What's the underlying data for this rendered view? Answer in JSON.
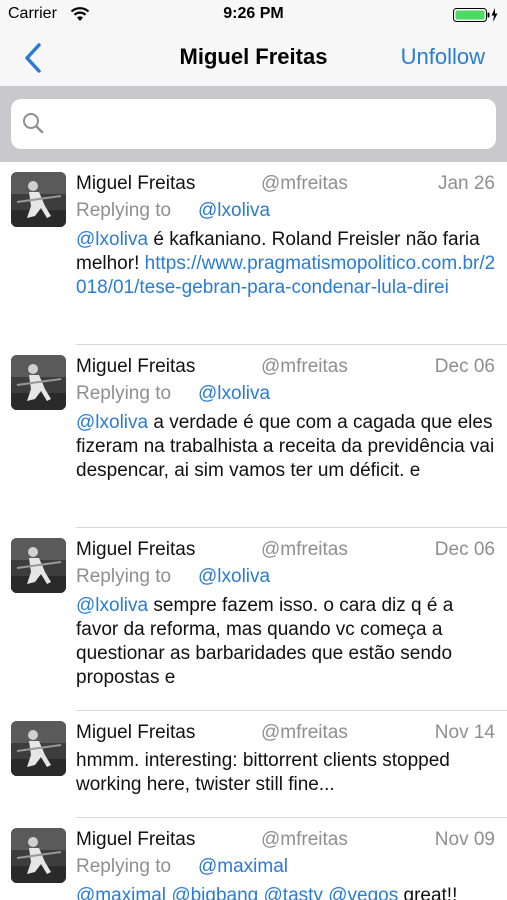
{
  "status_bar": {
    "carrier": "Carrier",
    "time": "9:26 PM",
    "icons": [
      "wifi-icon",
      "battery-icon"
    ],
    "battery_color": "#4cd964"
  },
  "nav": {
    "back_icon": "chevron-left-icon",
    "title": "Miguel Freitas",
    "unfollow_label": "Unfollow",
    "accent_color": "#2a7bd6"
  },
  "search": {
    "placeholder": "",
    "value": "",
    "icon": "search-icon"
  },
  "tweets": [
    {
      "name": "Miguel Freitas",
      "handle": "@mfreitas",
      "date": "Jan 26",
      "reply_prefix": "Replying to",
      "reply_user": "@lxoliva",
      "mention": "@lxoliva",
      "text": " é kafkaniano. Roland Freisler não faria melhor! ",
      "link": "https://www.pragmatismopolitico.com.br/2018/01/tese-gebran-para-condenar-lula-direi"
    },
    {
      "name": "Miguel Freitas",
      "handle": "@mfreitas",
      "date": "Dec 06",
      "reply_prefix": "Replying to",
      "reply_user": "@lxoliva",
      "mention": "@lxoliva",
      "text": " a verdade é que com a cagada que eles fizeram na trabalhista a receita da previdência vai despencar, ai sim vamos ter um déficit. e"
    },
    {
      "name": "Miguel Freitas",
      "handle": "@mfreitas",
      "date": "Dec 06",
      "reply_prefix": "Replying to",
      "reply_user": "@lxoliva",
      "mention": "@lxoliva",
      "text": " sempre fazem isso. o cara diz q é a favor da reforma, mas quando vc começa a questionar as barbaridades que estão sendo propostas e"
    },
    {
      "name": "Miguel Freitas",
      "handle": "@mfreitas",
      "date": "Nov 14",
      "text": "hmmm. interesting: bittorrent clients stopped working here, twister still fine..."
    },
    {
      "name": "Miguel Freitas",
      "handle": "@mfreitas",
      "date": "Nov 09",
      "reply_prefix": "Replying to",
      "reply_user": "@maximal",
      "mentions": [
        "@maximal",
        "@bigbang",
        "@tasty",
        "@vegos"
      ],
      "text": " great!!"
    }
  ]
}
